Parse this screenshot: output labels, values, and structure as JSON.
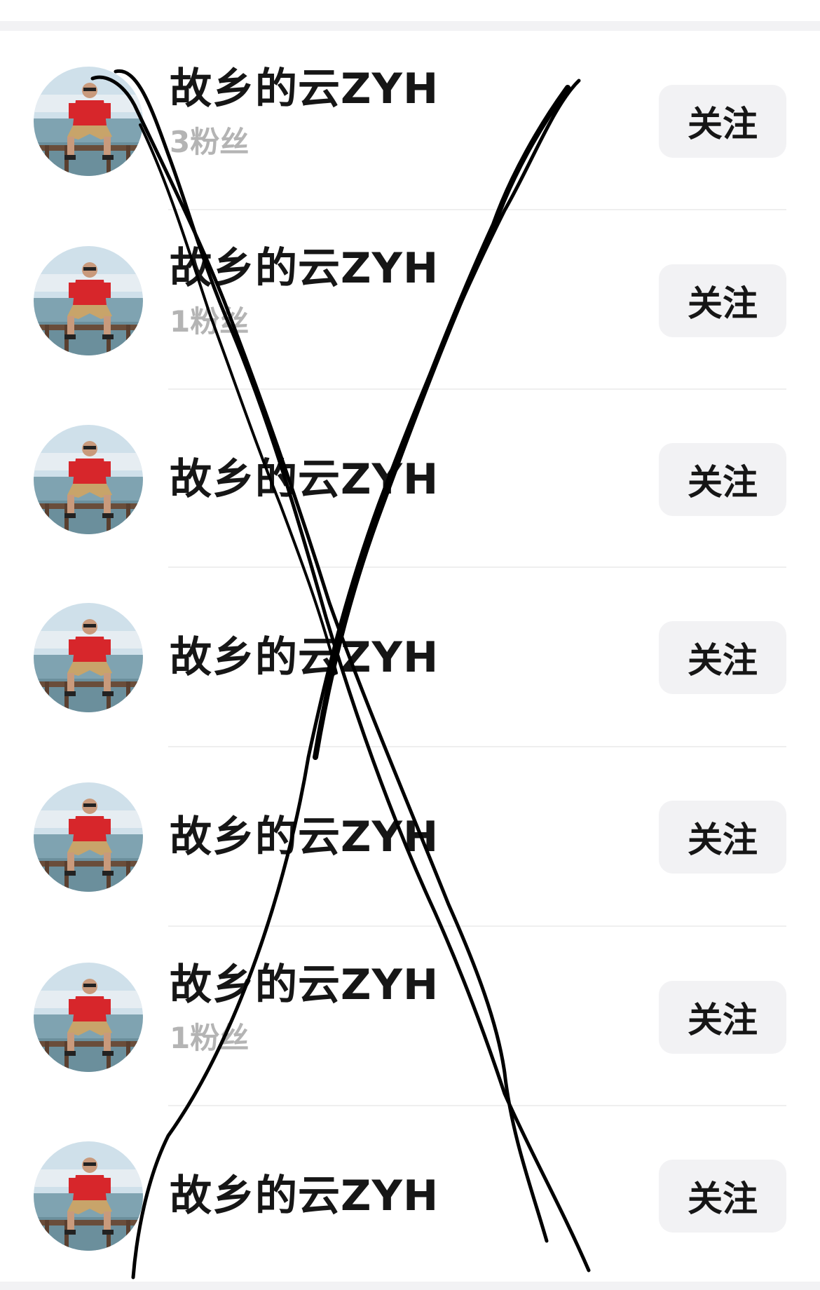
{
  "follow_list": {
    "rows": [
      {
        "name": "故乡的云ZYH",
        "fans": "3粉丝",
        "button": "关注"
      },
      {
        "name": "故乡的云ZYH",
        "fans": "1粉丝",
        "button": "关注"
      },
      {
        "name": "故乡的云ZYH",
        "fans": "",
        "button": "关注"
      },
      {
        "name": "故乡的云ZYH",
        "fans": "",
        "button": "关注"
      },
      {
        "name": "故乡的云ZYH",
        "fans": "",
        "button": "关注"
      },
      {
        "name": "故乡的云ZYH",
        "fans": "1粉丝",
        "button": "关注"
      },
      {
        "name": "故乡的云ZYH",
        "fans": "",
        "button": "关注"
      }
    ]
  },
  "colors": {
    "name_text": "#161616",
    "fans_text": "#b4b4b4",
    "button_bg": "#f2f2f4",
    "divider": "#efefef",
    "scribble_ink": "#000000"
  }
}
